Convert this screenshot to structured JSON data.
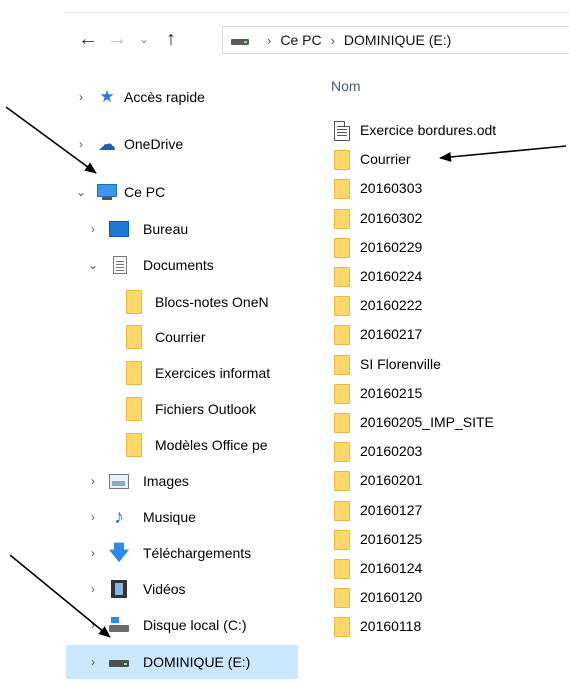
{
  "address_bar": {
    "crumbs": [
      "Ce PC",
      "DOMINIQUE (E:)"
    ]
  },
  "nav_pane": {
    "quick_access": "Accès rapide",
    "onedrive": "OneDrive",
    "this_pc": "Ce PC",
    "bureau": "Bureau",
    "documents": "Documents",
    "documents_children": [
      "Blocs-notes OneN",
      "Courrier",
      "Exercices informat",
      "Fichiers Outlook",
      "Modèles Office pe"
    ],
    "images": "Images",
    "musique": "Musique",
    "telechargements": "Téléchargements",
    "videos": "Vidéos",
    "disque_local": "Disque local (C:)",
    "dominique": "DOMINIQUE (E:)"
  },
  "file_list": {
    "column_name": "Nom",
    "items": [
      {
        "name": "Exercice bordures.odt",
        "type": "odt"
      },
      {
        "name": "Courrier",
        "type": "folder"
      },
      {
        "name": "20160303",
        "type": "folder"
      },
      {
        "name": "20160302",
        "type": "folder"
      },
      {
        "name": "20160229",
        "type": "folder"
      },
      {
        "name": "20160224",
        "type": "folder"
      },
      {
        "name": "20160222",
        "type": "folder"
      },
      {
        "name": "20160217",
        "type": "folder"
      },
      {
        "name": "SI Florenville",
        "type": "folder"
      },
      {
        "name": "20160215",
        "type": "folder"
      },
      {
        "name": "20160205_IMP_SITE",
        "type": "folder"
      },
      {
        "name": "20160203",
        "type": "folder"
      },
      {
        "name": "20160201",
        "type": "folder"
      },
      {
        "name": "20160127",
        "type": "folder"
      },
      {
        "name": "20160125",
        "type": "folder"
      },
      {
        "name": "20160124",
        "type": "folder"
      },
      {
        "name": "20160120",
        "type": "folder"
      },
      {
        "name": "20160118",
        "type": "folder"
      }
    ]
  },
  "colors": {
    "selection": "#cce8ff",
    "folder": "#ffd86b",
    "accent": "#1a7ad8"
  }
}
